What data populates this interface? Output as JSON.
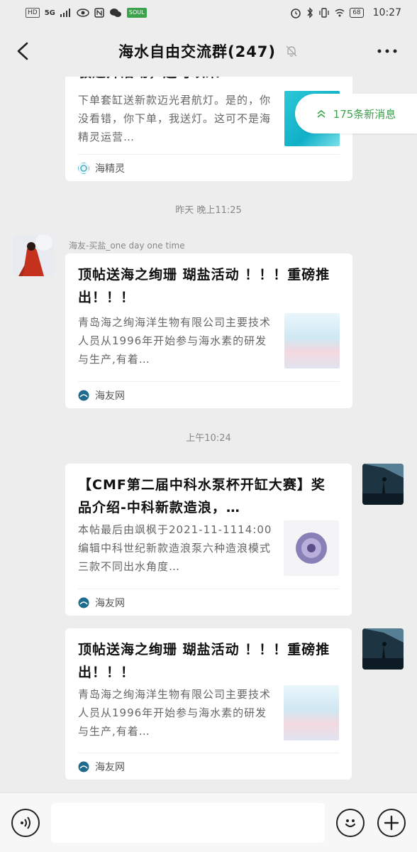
{
  "status_bar": {
    "left_badges": [
      "HD",
      "5G"
    ],
    "right_badge_sg": "SOUL",
    "battery": "68",
    "time": "10:27"
  },
  "header": {
    "title": "海水自由交流群(247)",
    "back_icon": "chevron-left-icon",
    "mute_icon": "bell-off-icon",
    "more_icon": "more-icon"
  },
  "new_messages": {
    "label": "175条新消息",
    "icon": "double-chevron-up-icon",
    "color": "#3aa24a"
  },
  "messages": [
    {
      "type": "link-card",
      "side": "left",
      "partial_title": "极速开活动，还可以来",
      "desc": "下单套缸送新款迈光君航灯。是的，你没看错，你下单，我送灯。这可不是海精灵运营…",
      "source": "海精灵"
    },
    {
      "type": "time",
      "label": "昨天 晚上11:25"
    },
    {
      "type": "link-card",
      "side": "left",
      "sender": "海友-买盐_one day one time",
      "title": "顶帖送海之绚珊 瑚盐活动 ！！！重磅推出！！！",
      "desc": "青岛海之绚海洋生物有限公司主要技术人员从1996年开始参与海水素的研发与生产,有着…",
      "source": "海友网"
    },
    {
      "type": "time",
      "label": "上午10:24"
    },
    {
      "type": "link-card",
      "side": "right",
      "title": "【CMF第二届中科水泵杯开缸大赛】奖品介绍-中科新款造浪，…",
      "desc": "本帖最后由飒枫于2021-11-1114:00编辑中科世纪新款造浪泵六种造浪模式三款不同出水角度…",
      "source": "海友网"
    },
    {
      "type": "link-card",
      "side": "right",
      "title": "顶帖送海之绚珊 瑚盐活动 ！！！重磅推出！！！",
      "desc": "青岛海之绚海洋生物有限公司主要技术人员从1996年开始参与海水素的研发与生产,有着…",
      "source": "海友网"
    }
  ],
  "input_bar": {
    "voice_icon": "voice-icon",
    "emoji_icon": "emoji-icon",
    "add_icon": "plus-circle-icon",
    "placeholder": ""
  }
}
